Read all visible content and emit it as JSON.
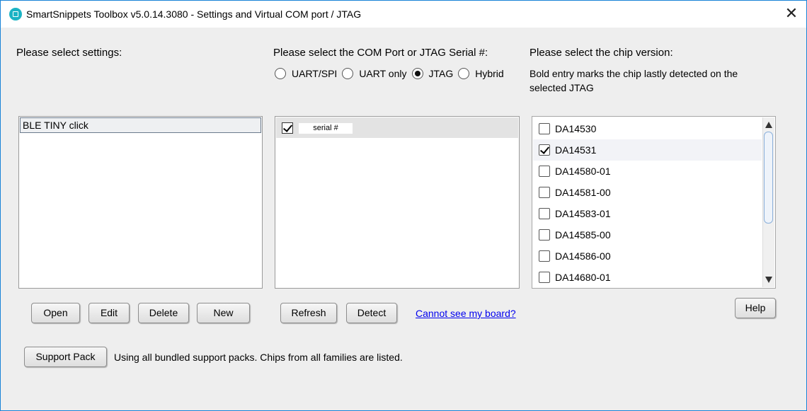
{
  "window": {
    "title": "SmartSnippets Toolbox v5.0.14.3080 - Settings and Virtual COM port / JTAG",
    "close_glyph": "✕",
    "icon": "smartsnippets-app-icon"
  },
  "settings": {
    "heading": "Please select settings:",
    "items": [
      "BLE TINY click"
    ],
    "buttons": {
      "open": "Open",
      "edit": "Edit",
      "delete": "Delete",
      "new": "New"
    }
  },
  "port": {
    "heading": "Please select the COM Port or JTAG Serial #:",
    "options": [
      {
        "label": "UART/SPI",
        "selected": false
      },
      {
        "label": "UART only",
        "selected": false
      },
      {
        "label": "JTAG",
        "selected": true
      },
      {
        "label": "Hybrid",
        "selected": false
      }
    ],
    "rows": [
      {
        "checked": true,
        "value": "serial #"
      }
    ],
    "buttons": {
      "refresh": "Refresh",
      "detect": "Detect"
    },
    "link": "Cannot see my board?"
  },
  "chip": {
    "heading": "Please select the chip version:",
    "note": "Bold entry marks the chip lastly detected on the selected JTAG",
    "items": [
      {
        "label": "DA14530",
        "checked": false
      },
      {
        "label": "DA14531",
        "checked": true
      },
      {
        "label": "DA14580-01",
        "checked": false
      },
      {
        "label": "DA14581-00",
        "checked": false
      },
      {
        "label": "DA14583-01",
        "checked": false
      },
      {
        "label": "DA14585-00",
        "checked": false
      },
      {
        "label": "DA14586-00",
        "checked": false
      },
      {
        "label": "DA14680-01",
        "checked": false
      }
    ],
    "help_button": "Help"
  },
  "support": {
    "button": "Support Pack",
    "status": "Using all bundled support packs. Chips from all families are listed."
  },
  "colors": {
    "window_border": "#1883d7",
    "app_icon": "#1bb3c4",
    "link": "#0000ee"
  }
}
